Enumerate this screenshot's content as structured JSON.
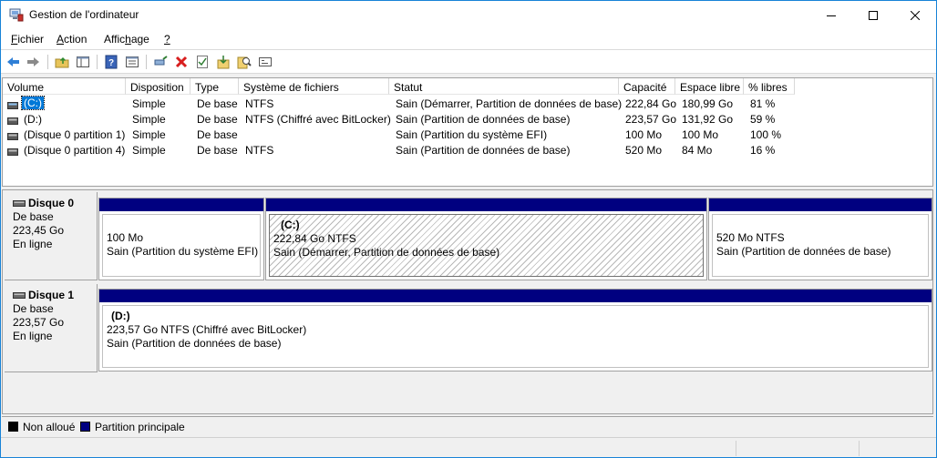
{
  "window": {
    "title": "Gestion de l'ordinateur"
  },
  "menu": [
    {
      "pre": "",
      "ul": "F",
      "post": "ichier"
    },
    {
      "pre": "",
      "ul": "A",
      "post": "ction"
    },
    {
      "pre": "Affic",
      "ul": "h",
      "post": "age"
    },
    {
      "pre": "",
      "ul": "?",
      "post": ""
    }
  ],
  "toolbar": {
    "icons": [
      "back-icon",
      "forward-icon",
      "up-folder-icon",
      "show-hide-tree-icon",
      "help-icon",
      "properties-icon",
      "connect-icon",
      "delete-icon",
      "check-icon",
      "import-icon",
      "search-icon",
      "console-icon"
    ]
  },
  "volumes": {
    "columns": [
      "Volume",
      "Disposition",
      "Type",
      "Système de fichiers",
      "Statut",
      "Capacité",
      "Espace libre",
      "% libres"
    ],
    "rows": [
      [
        "(C:)",
        "Simple",
        "De base",
        "NTFS",
        "Sain (Démarrer, Partition de données de base)",
        "222,84 Go",
        "180,99 Go",
        "81 %"
      ],
      [
        "(D:)",
        "Simple",
        "De base",
        "NTFS (Chiffré avec BitLocker)",
        "Sain (Partition de données de base)",
        "223,57 Go",
        "131,92 Go",
        "59 %"
      ],
      [
        "(Disque 0 partition 1)",
        "Simple",
        "De base",
        "",
        "Sain (Partition du système EFI)",
        "100 Mo",
        "100 Mo",
        "100 %"
      ],
      [
        "(Disque 0 partition 4)",
        "Simple",
        "De base",
        "NTFS",
        "Sain (Partition de données de base)",
        "520 Mo",
        "84 Mo",
        "16 %"
      ]
    ]
  },
  "disks": [
    {
      "name": "Disque 0",
      "type": "De base",
      "size": "223,45 Go",
      "state": "En ligne",
      "partitions": [
        {
          "label": "",
          "size": "100 Mo",
          "status": "Sain (Partition du système EFI)"
        },
        {
          "label": "(C:)",
          "size": "222,84 Go NTFS",
          "status": "Sain (Démarrer, Partition de données de base)"
        },
        {
          "label": "",
          "size": "520 Mo NTFS",
          "status": "Sain (Partition de données de base)"
        }
      ]
    },
    {
      "name": "Disque 1",
      "type": "De base",
      "size": "223,57 Go",
      "state": "En ligne",
      "partitions": [
        {
          "label": "(D:)",
          "size": "223,57 Go NTFS (Chiffré avec BitLocker)",
          "status": "Sain (Partition de données de base)"
        }
      ]
    }
  ],
  "legend": [
    {
      "label": "Non alloué",
      "color": "#000000"
    },
    {
      "label": "Partition principale",
      "color": "#000080"
    }
  ],
  "colors": {
    "accent": "#0078d7",
    "primary_partition": "#000080"
  }
}
